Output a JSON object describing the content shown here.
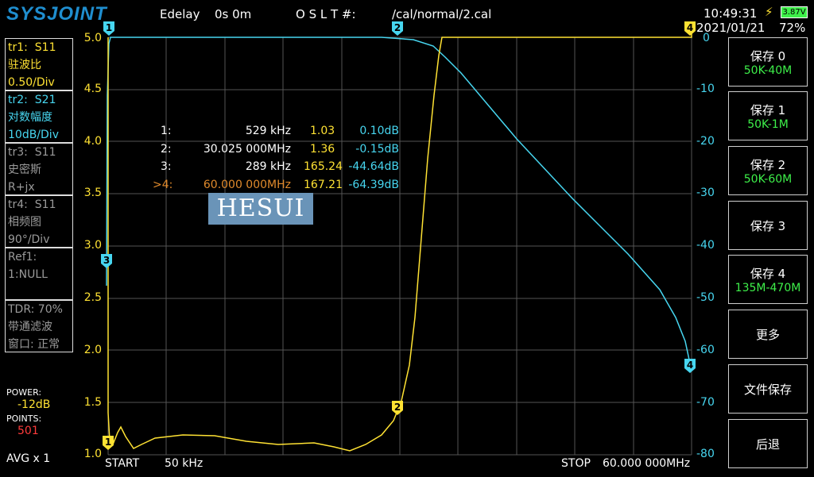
{
  "header": {
    "logo": "SYSJOINT",
    "edelay_label": "Edelay",
    "edelay_value": "0s 0m",
    "oslt_label": "O S L T #:",
    "cal_path": "/cal/normal/2.cal",
    "time": "10:49:31",
    "battery_voltage": "3.87V",
    "date": "2021/01/21",
    "battery_percent": "72%"
  },
  "traces": [
    {
      "id": "tr1:",
      "param": "S11",
      "format": "驻波比",
      "scale": "0.50/Div",
      "color": "#ffe233"
    },
    {
      "id": "tr2:",
      "param": "S21",
      "format": "对数幅度",
      "scale": "10dB/Div",
      "color": "#47d6f0"
    },
    {
      "id": "tr3:",
      "param": "S11",
      "format": "史密斯",
      "scale": "R+jx",
      "color": "#9a9a9a"
    },
    {
      "id": "tr4:",
      "param": "S11",
      "format": "相频图",
      "scale": "90°/Div",
      "color": "#9a9a9a"
    }
  ],
  "ref": {
    "label": "Ref1:",
    "value": "1:NULL"
  },
  "tdr": {
    "line1": "TDR: 70%",
    "line2": "带通滤波",
    "line3": "窗口: 正常"
  },
  "power": {
    "label": "POWER:",
    "value": "-12dB"
  },
  "points": {
    "label": "POINTS:",
    "value": "501"
  },
  "avg": "AVG x 1",
  "start": {
    "label": "START",
    "value": "50 kHz"
  },
  "stop": {
    "label": "STOP",
    "value": "60.000 000MHz"
  },
  "watermark": "HESUI",
  "left_axis": [
    "5.0",
    "4.5",
    "4.0",
    "3.5",
    "3.0",
    "2.5",
    "2.0",
    "1.5",
    "1.0"
  ],
  "right_axis": [
    "0",
    "-10",
    "-20",
    "-30",
    "-40",
    "-50",
    "-60",
    "-70",
    "-80"
  ],
  "markers": [
    {
      "num": "1:",
      "freq": "529 kHz",
      "swr": "1.03",
      "db": "0.10dB"
    },
    {
      "num": "2:",
      "freq": "30.025 000MHz",
      "swr": "1.36",
      "db": "-0.15dB"
    },
    {
      "num": "3:",
      "freq": "289 kHz",
      "swr": "165.24",
      "db": "-44.64dB"
    },
    {
      "num": ">4:",
      "freq": "60.000 000MHz",
      "swr": "167.21",
      "db": "-64.39dB"
    }
  ],
  "buttons": [
    {
      "title": "保存 0",
      "sub": "50K-40M"
    },
    {
      "title": "保存 1",
      "sub": "50K-1M"
    },
    {
      "title": "保存 2",
      "sub": "50K-60M"
    },
    {
      "title": "保存 3",
      "sub": ""
    },
    {
      "title": "保存 4",
      "sub": "135M-470M"
    },
    {
      "title": "更多",
      "sub": ""
    },
    {
      "title": "文件保存",
      "sub": ""
    },
    {
      "title": "后退",
      "sub": ""
    }
  ],
  "colors": {
    "trace1": "#ffe233",
    "trace2": "#47d6f0",
    "grid": "#555555",
    "accent_green": "#3ef04a",
    "marker_active": "#e08a2c"
  }
}
